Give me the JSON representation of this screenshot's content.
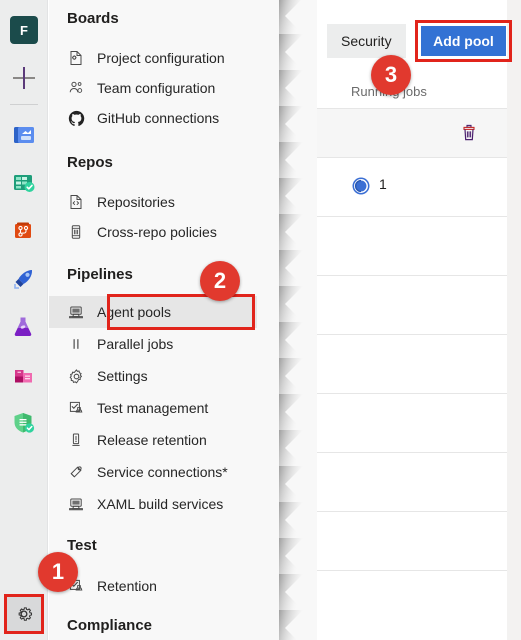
{
  "rail": {
    "org_initial": "F",
    "add_label": "+",
    "items": [
      {
        "name": "boards-icon",
        "label": "Boards"
      },
      {
        "name": "test-plans-grid-icon",
        "label": "Test Plans"
      },
      {
        "name": "repos-icon",
        "label": "Repos"
      },
      {
        "name": "pipelines-rocket-icon",
        "label": "Pipelines"
      },
      {
        "name": "test-plans-flask-icon",
        "label": "Test Plans"
      },
      {
        "name": "artifacts-icon",
        "label": "Artifacts"
      },
      {
        "name": "security-shield-icon",
        "label": "Security"
      }
    ],
    "settings_label": "Project settings"
  },
  "nav": {
    "sections": [
      {
        "title": "Boards",
        "items": [
          {
            "icon": "project-configuration-icon",
            "label": "Project configuration"
          },
          {
            "icon": "team-configuration-icon",
            "label": "Team configuration"
          },
          {
            "icon": "github-icon",
            "label": "GitHub connections"
          }
        ]
      },
      {
        "title": "Repos",
        "items": [
          {
            "icon": "repositories-icon",
            "label": "Repositories"
          },
          {
            "icon": "cross-repo-policies-icon",
            "label": "Cross-repo policies"
          }
        ]
      },
      {
        "title": "Pipelines",
        "items": [
          {
            "icon": "agent-pools-icon",
            "label": "Agent pools"
          },
          {
            "icon": "parallel-jobs-icon",
            "label": "Parallel jobs"
          },
          {
            "icon": "settings-gear-icon",
            "label": "Settings"
          },
          {
            "icon": "test-management-icon",
            "label": "Test management"
          },
          {
            "icon": "release-retention-icon",
            "label": "Release retention"
          },
          {
            "icon": "service-connections-icon",
            "label": "Service connections*"
          },
          {
            "icon": "xaml-build-services-icon",
            "label": "XAML build services"
          }
        ]
      },
      {
        "title": "Test",
        "items": [
          {
            "icon": "retention-icon",
            "label": "Retention"
          }
        ]
      },
      {
        "title": "Compliance",
        "items": []
      }
    ],
    "selected_item": "Agent pools"
  },
  "content": {
    "tab_label": "Security",
    "add_pool_label": "Add pool",
    "column_header": "Running jobs",
    "delete_icon_label": "Delete",
    "pool_count": "1"
  },
  "callouts": {
    "one": "1",
    "two": "2",
    "three": "3",
    "color": "#e1392e",
    "highlight_color": "#e1241b"
  }
}
